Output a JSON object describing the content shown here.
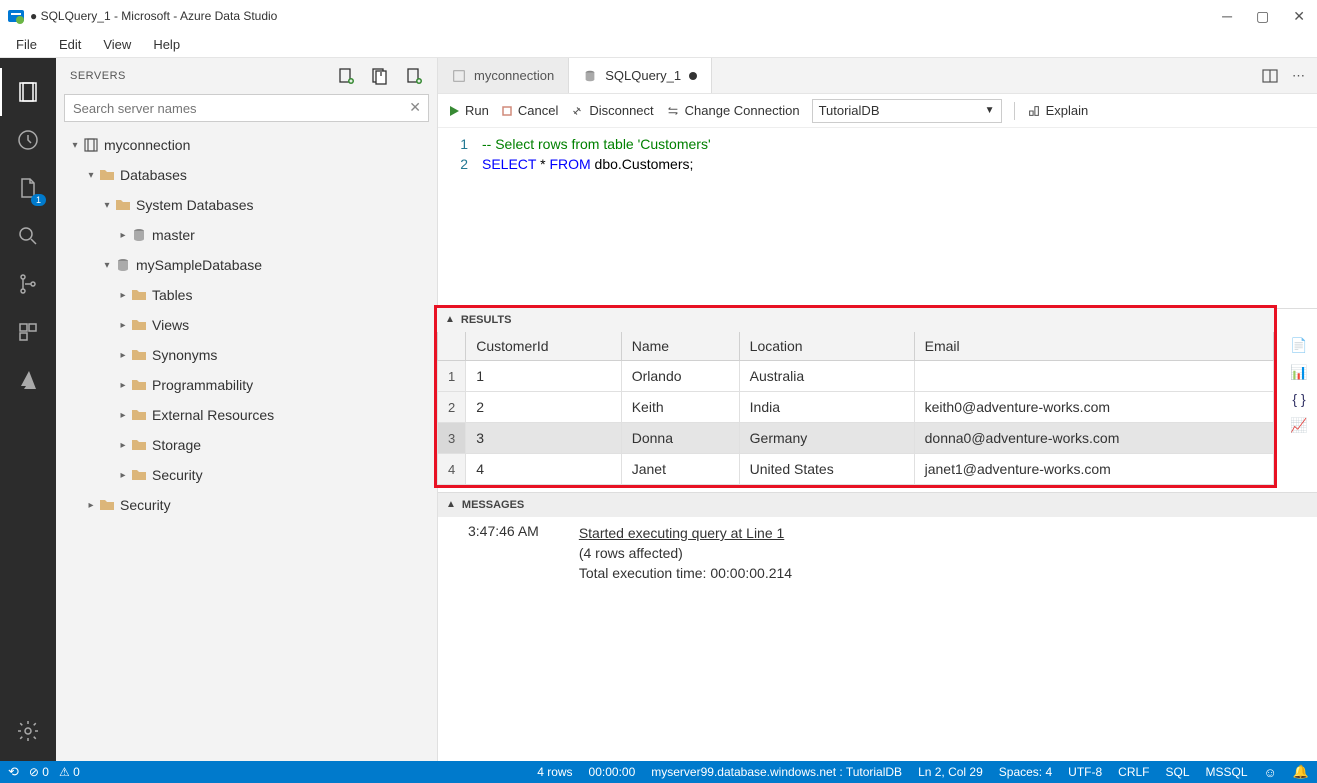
{
  "window": {
    "title": "● SQLQuery_1 - Microsoft - Azure Data Studio"
  },
  "menubar": [
    "File",
    "Edit",
    "View",
    "Help"
  ],
  "sidebar": {
    "title": "SERVERS",
    "search_placeholder": "Search server names",
    "tree": {
      "connection": "myconnection",
      "databases_label": "Databases",
      "system_db_label": "System Databases",
      "master_label": "master",
      "sample_db_label": "mySampleDatabase",
      "folders": [
        "Tables",
        "Views",
        "Synonyms",
        "Programmability",
        "External Resources",
        "Storage",
        "Security"
      ],
      "security_label": "Security"
    }
  },
  "tabs": {
    "tab1": "myconnection",
    "tab2": "SQLQuery_1"
  },
  "toolbar": {
    "run": "Run",
    "cancel": "Cancel",
    "disconnect": "Disconnect",
    "change_conn": "Change Connection",
    "conn_db": "TutorialDB",
    "explain": "Explain"
  },
  "code": {
    "line1_num": "1",
    "line2_num": "2",
    "comment": "-- Select rows from table 'Customers'",
    "kw_select": "SELECT",
    "star": " * ",
    "kw_from": "FROM",
    "rest": " dbo.Customers;"
  },
  "results": {
    "title": "RESULTS",
    "columns": [
      "CustomerId",
      "Name",
      "Location",
      "Email"
    ],
    "rows": [
      {
        "n": "1",
        "id": "1",
        "name": "Orlando",
        "loc": "Australia",
        "email": ""
      },
      {
        "n": "2",
        "id": "2",
        "name": "Keith",
        "loc": "India",
        "email": "keith0@adventure-works.com"
      },
      {
        "n": "3",
        "id": "3",
        "name": "Donna",
        "loc": "Germany",
        "email": "donna0@adventure-works.com"
      },
      {
        "n": "4",
        "id": "4",
        "name": "Janet",
        "loc": "United States",
        "email": "janet1@adventure-works.com"
      }
    ]
  },
  "messages": {
    "title": "MESSAGES",
    "time": "3:47:46 AM",
    "line1": "Started executing query at Line 1",
    "line2": "(4 rows affected)",
    "line3": "Total execution time: 00:00:00.214"
  },
  "statusbar": {
    "errors": "0",
    "warnings": "0",
    "rows": "4 rows",
    "elapsed": "00:00:00",
    "server": "myserver99.database.windows.net : TutorialDB",
    "pos": "Ln 2, Col 29",
    "spaces": "Spaces: 4",
    "encoding": "UTF-8",
    "eol": "CRLF",
    "lang": "SQL",
    "mode": "MSSQL"
  },
  "activitybar": {
    "explorer_badge": "1"
  }
}
